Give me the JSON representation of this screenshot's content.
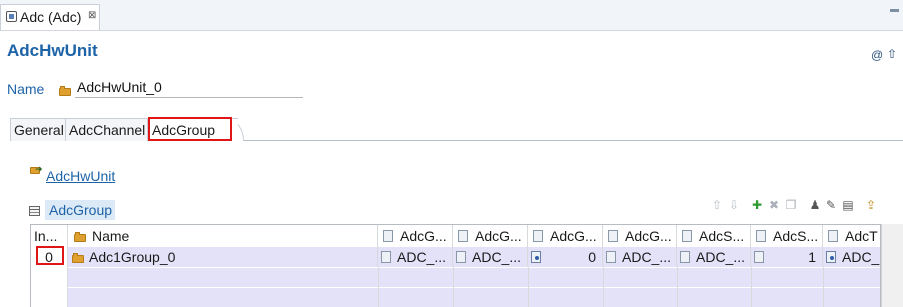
{
  "editor_tab": {
    "title": "Adc (Adc)",
    "close": "⊠"
  },
  "page": {
    "title": "AdcHwUnit",
    "help_icon": "@",
    "up_icon": "⇧"
  },
  "name_field": {
    "label": "Name",
    "value": "AdcHwUnit_0"
  },
  "tabs": [
    {
      "label": "General"
    },
    {
      "label": "AdcChannel"
    },
    {
      "label": "AdcGroup"
    }
  ],
  "link": {
    "label": "AdcHwUnit"
  },
  "group": {
    "title": "AdcGroup"
  },
  "toolbar": {
    "up": "⇧",
    "down": "⇩",
    "add": "✚",
    "remove": "✖",
    "copy": "❐",
    "user": "♟",
    "edit": "✎",
    "props": "▤",
    "import": "⇪"
  },
  "table": {
    "columns": [
      "In...",
      "Name",
      "AdcG...",
      "AdcG...",
      "AdcG...",
      "AdcG...",
      "AdcS...",
      "AdcS...",
      "AdcT"
    ],
    "rows": [
      {
        "index": "0",
        "name": "Adc1Group_0",
        "c1": "ADC_...",
        "c2": "ADC_...",
        "c3": "0",
        "c4": "ADC_...",
        "c5": "ADC_...",
        "c6": "1",
        "c7": "ADC_I"
      }
    ]
  },
  "colors": {
    "accent": "#1d63a8",
    "highlight": "#e01515",
    "row_selected": "#e4e2f8"
  }
}
